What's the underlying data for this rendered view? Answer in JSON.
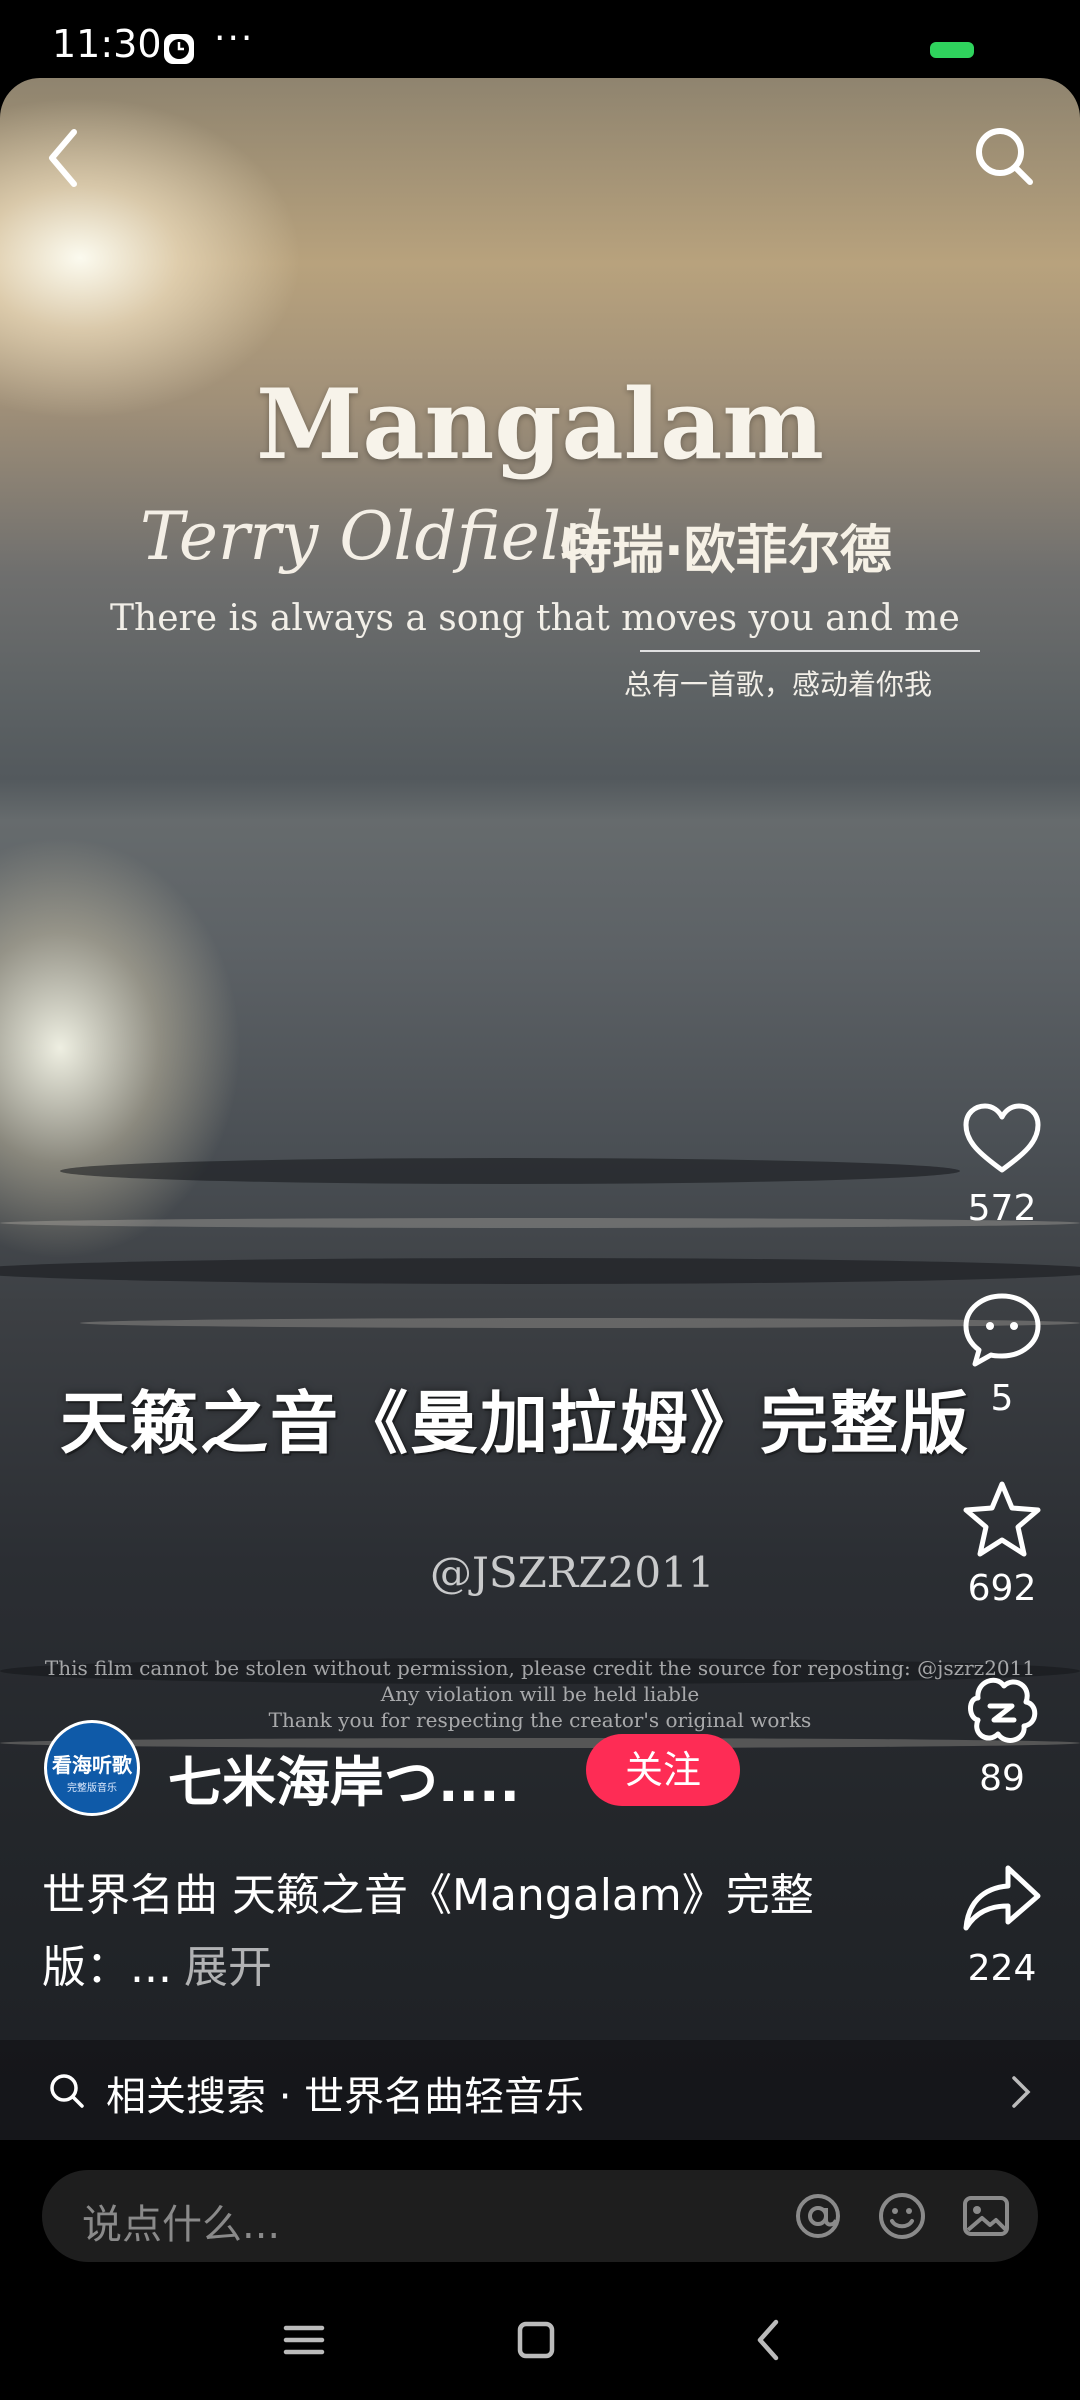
{
  "status_bar": {
    "time": "11:30",
    "more": "···"
  },
  "video": {
    "title": "Mangalam",
    "artist_en": "Terry Oldfield",
    "artist_cn": "特瑞·欧菲尔德",
    "tagline_en": "There is always a song that moves you and me",
    "tagline_cn": "总有一首歌，感动着你我",
    "overlay_title": "天籁之音《曼加拉姆》完整版",
    "watermark": "@JSZRZ2011",
    "watermark_lines": [
      "This film cannot be stolen without permission, please credit the source for reposting: @jszrz2011",
      "Any violation will be held liable",
      "Thank you for respecting the creator's original works"
    ]
  },
  "rail": {
    "likes": "572",
    "comments": "5",
    "favorites": "692",
    "gifts": "89",
    "shares": "224"
  },
  "author": {
    "avatar_text": "看海听歌",
    "avatar_sub": "完整版音乐",
    "name": "七米海岸つ....",
    "follow_label": "关注"
  },
  "caption": {
    "text": "世界名曲 天籁之音《Mangalam》完整版：...",
    "expand": "展开"
  },
  "related": {
    "text": "相关搜索 · 世界名曲轻音乐"
  },
  "comment": {
    "placeholder": "说点什么..."
  },
  "icons": {
    "back": "back-arrow-icon",
    "search": "search-icon",
    "like": "heart-icon",
    "comment": "comment-bubble-icon",
    "favorite": "star-icon",
    "gift": "gift-icon",
    "share": "share-arrow-icon",
    "mention": "at-icon",
    "emoji": "emoji-icon",
    "image": "image-icon"
  },
  "colors": {
    "follow": "#fe2c55",
    "battery": "#2fd35d"
  }
}
